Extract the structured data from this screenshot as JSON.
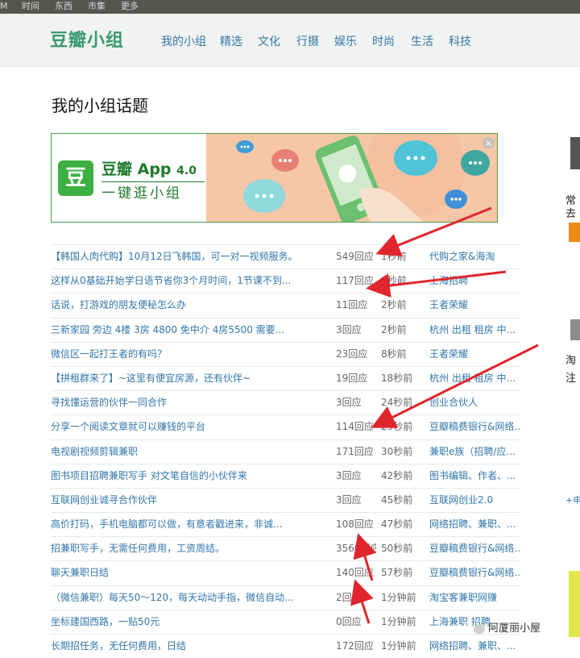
{
  "topbar": {
    "items": [
      "M",
      "时间",
      "东西",
      "市集",
      "更多"
    ]
  },
  "header": {
    "logo": "豆瓣小组",
    "nav": [
      "我的小组",
      "精选",
      "文化",
      "行摄",
      "娱乐",
      "时尚",
      "生活",
      "科技"
    ]
  },
  "page_title": "我的小组话题",
  "banner": {
    "icon_char": "豆",
    "app_name": "豆瓣 App",
    "app_version": "4.0",
    "tagline": "一键逛小组",
    "close": "×",
    "colors": {
      "brand_green": "#3eb042",
      "peach": "#f6c7a6"
    }
  },
  "topics": [
    {
      "title": "【韩国人肉代购】10月12日飞韩国，可一对一视频服务。",
      "replies": "549回应",
      "time": "1秒前",
      "group": "代购之家&海淘"
    },
    {
      "title": "这样从0基础开始学日语节省你3个月时间，1节课不到...",
      "replies": "117回应",
      "time": "1秒前",
      "group": "上海招聘"
    },
    {
      "title": "话说，打游戏的朋友便秘怎么办",
      "replies": "11回应",
      "time": "2秒前",
      "group": "王者荣耀"
    },
    {
      "title": "三新家园 旁边 4楼 3房 4800 免中介 4房5500 需要...",
      "replies": "3回应",
      "time": "2秒前",
      "group": "杭州 出租 租房 中..."
    },
    {
      "title": "微信区一起打王者的有吗？",
      "replies": "23回应",
      "time": "8秒前",
      "group": "王者荣耀"
    },
    {
      "title": "【拼租群来了】~这里有便宜房源，还有伙伴~",
      "replies": "19回应",
      "time": "18秒前",
      "group": "杭州 出租 租房 中..."
    },
    {
      "title": "寻找懂运营的伙伴一同合作",
      "replies": "3回应",
      "time": "24秒前",
      "group": "创业合伙人"
    },
    {
      "title": "分享一个阅读文章就可以赚钱的平台",
      "replies": "114回应",
      "time": "29秒前",
      "group": "豆瓣稿费银行&网络..."
    },
    {
      "title": "电视剧视频剪辑兼职",
      "replies": "171回应",
      "time": "30秒前",
      "group": "兼职e族（招聘/应..."
    },
    {
      "title": "图书项目招聘兼职写手 对文笔自信的小伙伴来",
      "replies": "3回应",
      "time": "42秒前",
      "group": "图书编辑、作者、..."
    },
    {
      "title": "互联网创业诚寻合作伙伴",
      "replies": "3回应",
      "time": "45秒前",
      "group": "互联网创业2.0"
    },
    {
      "title": "高价打码，手机电脑都可以做，有意者戳进来，非诚...",
      "replies": "108回应",
      "time": "47秒前",
      "group": "网络招聘、兼职、..."
    },
    {
      "title": "招兼职写手，无需任何费用，工资周结。",
      "replies": "3569回应",
      "time": "50秒前",
      "group": "豆瓣稿费银行&网络..."
    },
    {
      "title": "聊天兼职日结",
      "replies": "140回应",
      "time": "57秒前",
      "group": "豆瓣稿费银行&网络..."
    },
    {
      "title": "（微信兼职）每天50～120，每天动动手指，微信自动...",
      "replies": "2回应",
      "time": "1分钟前",
      "group": "淘宝客兼职网赚"
    },
    {
      "title": "坐标建国西路，一贴50元",
      "replies": "0回应",
      "time": "1分钟前",
      "group": "上海兼职 招聘"
    },
    {
      "title": "长期招任务，无任何费用，日结",
      "replies": "172回应",
      "time": "1分钟前",
      "group": "网络招聘、兼职、..."
    }
  ],
  "side": {
    "heading_fragment": "常去",
    "orange_char": "淘",
    "fragment_a": "淘",
    "fragment_b": "注",
    "fragment_c": "+申"
  },
  "watermark": "阿厦丽小屋",
  "annotation_color": "#e0262c"
}
